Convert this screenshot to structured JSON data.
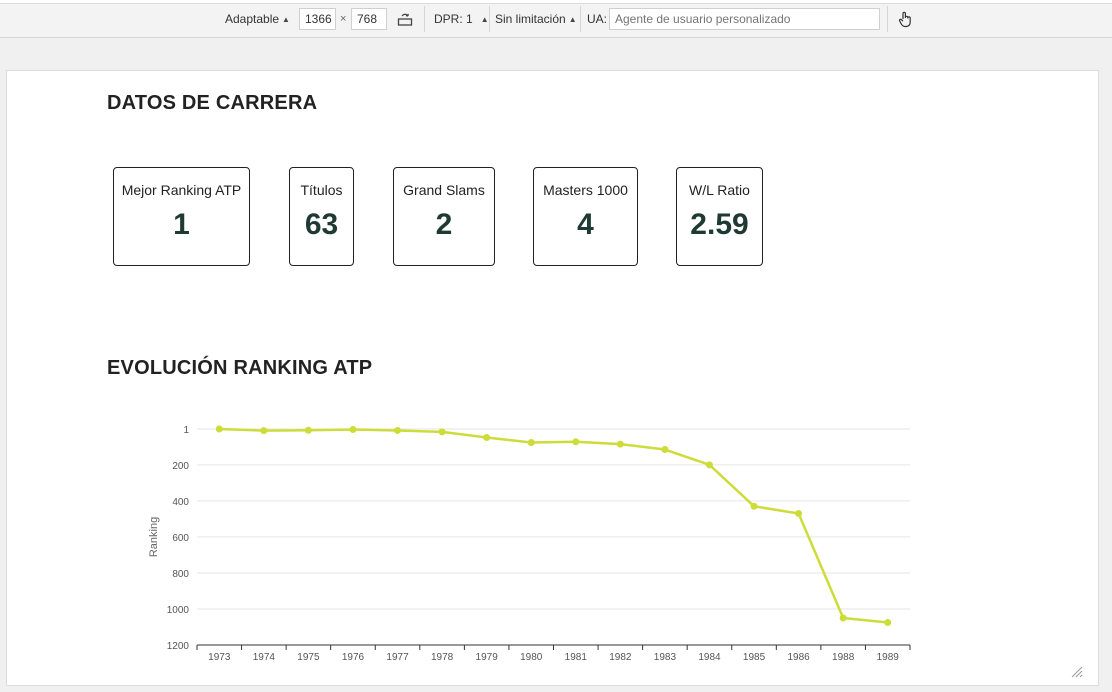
{
  "toolbar": {
    "device": "Adaptable",
    "width": "1366",
    "times": "×",
    "height": "768",
    "dpr": "DPR: 1",
    "throttle": "Sin limitación",
    "ua_label": "UA:",
    "ua_placeholder": "Agente de usuario personalizado"
  },
  "page": {
    "career_title": "DATOS DE CARRERA",
    "stats": [
      {
        "label": "Mejor Ranking ATP",
        "value": "1"
      },
      {
        "label": "Títulos",
        "value": "63"
      },
      {
        "label": "Grand Slams",
        "value": "2"
      },
      {
        "label": "Masters 1000",
        "value": "4"
      },
      {
        "label": "W/L Ratio",
        "value": "2.59"
      }
    ],
    "ranking_title": "EVOLUCIÓN RANKING ATP"
  },
  "colors": {
    "line": "#cddc39",
    "value_text": "#1f3a33"
  },
  "chart_data": {
    "type": "line",
    "title": "",
    "xlabel": "",
    "ylabel": "Ranking",
    "y_inverted": true,
    "ylim": [
      1,
      1200
    ],
    "yticks": [
      1,
      200,
      400,
      600,
      800,
      1000,
      1200
    ],
    "grid": true,
    "categories": [
      "1973",
      "1974",
      "1975",
      "1976",
      "1977",
      "1978",
      "1979",
      "1980",
      "1981",
      "1982",
      "1983",
      "1984",
      "1985",
      "1986",
      "1988",
      "1989"
    ],
    "series": [
      {
        "values": [
          1,
          10,
          8,
          4,
          9,
          17,
          48,
          76,
          72,
          85,
          115,
          200,
          430,
          470,
          1050,
          1075
        ]
      }
    ]
  }
}
